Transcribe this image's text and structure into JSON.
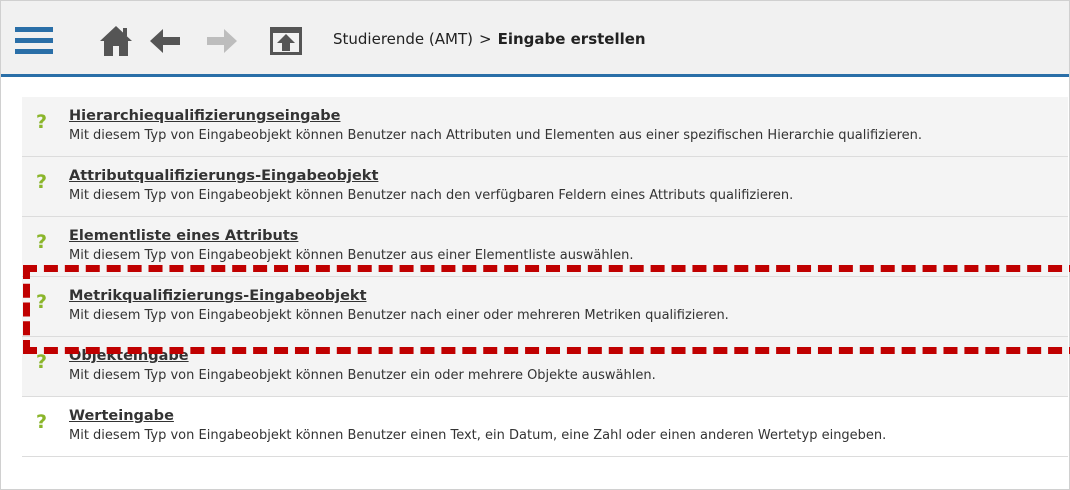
{
  "toolbar": {
    "icons": [
      "menu-icon",
      "home-icon",
      "back-arrow-icon",
      "forward-arrow-icon",
      "folder-up-icon"
    ],
    "breadcrumb": {
      "parent": "Studierende (AMT)",
      "separator": ">",
      "current": "Eingabe erstellen"
    },
    "accent_color": "#2a6fa8"
  },
  "items": [
    {
      "title": "Hierarchiequalifizierungseingabe",
      "description": "Mit diesem Typ von Eingabeobjekt können Benutzer nach Attributen und Elementen aus einer spezifischen Hierarchie qualifizieren.",
      "icon": "question-mark-icon"
    },
    {
      "title": "Attributqualifizierungs-Eingabeobjekt",
      "description": "Mit diesem Typ von Eingabeobjekt können Benutzer nach den verfügbaren Feldern eines Attributs qualifizieren.",
      "icon": "question-mark-icon"
    },
    {
      "title": "Elementliste eines Attributs",
      "description": "Mit diesem Typ von Eingabeobjekt können Benutzer aus einer Elementliste auswählen.",
      "icon": "question-mark-icon"
    },
    {
      "title": "Metrikqualifizierungs-Eingabeobjekt",
      "description": "Mit diesem Typ von Eingabeobjekt können Benutzer nach einer oder mehreren Metriken qualifizieren.",
      "icon": "question-mark-icon",
      "highlighted": true
    },
    {
      "title": "Objekteingabe",
      "description": "Mit diesem Typ von Eingabeobjekt können Benutzer ein oder mehrere Objekte auswählen.",
      "icon": "question-mark-icon"
    },
    {
      "title": "Werteingabe",
      "description": "Mit diesem Typ von Eingabeobjekt können Benutzer einen Text, ein Datum, eine Zahl oder einen anderen Wertetyp eingeben.",
      "icon": "question-mark-icon"
    }
  ],
  "colors": {
    "question_mark": "#8ab52a",
    "highlight_border": "#c00000"
  }
}
